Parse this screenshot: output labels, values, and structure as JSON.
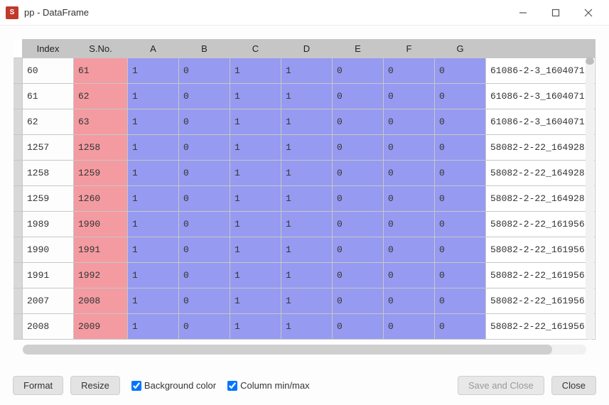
{
  "window": {
    "title": "pp - DataFrame",
    "app_icon_text": "S"
  },
  "table": {
    "columns": [
      "Index",
      "S.No.",
      "A",
      "B",
      "C",
      "D",
      "E",
      "F",
      "G",
      ""
    ],
    "rows": [
      {
        "index": "60",
        "sno": "61",
        "A": "1",
        "B": "0",
        "C": "1",
        "D": "1",
        "E": "0",
        "F": "0",
        "G": "0",
        "last": "61086-2-3_1604071"
      },
      {
        "index": "61",
        "sno": "62",
        "A": "1",
        "B": "0",
        "C": "1",
        "D": "1",
        "E": "0",
        "F": "0",
        "G": "0",
        "last": "61086-2-3_1604071"
      },
      {
        "index": "62",
        "sno": "63",
        "A": "1",
        "B": "0",
        "C": "1",
        "D": "1",
        "E": "0",
        "F": "0",
        "G": "0",
        "last": "61086-2-3_1604071"
      },
      {
        "index": "1257",
        "sno": "1258",
        "A": "1",
        "B": "0",
        "C": "1",
        "D": "1",
        "E": "0",
        "F": "0",
        "G": "0",
        "last": "58082-2-22_164928"
      },
      {
        "index": "1258",
        "sno": "1259",
        "A": "1",
        "B": "0",
        "C": "1",
        "D": "1",
        "E": "0",
        "F": "0",
        "G": "0",
        "last": "58082-2-22_164928"
      },
      {
        "index": "1259",
        "sno": "1260",
        "A": "1",
        "B": "0",
        "C": "1",
        "D": "1",
        "E": "0",
        "F": "0",
        "G": "0",
        "last": "58082-2-22_164928"
      },
      {
        "index": "1989",
        "sno": "1990",
        "A": "1",
        "B": "0",
        "C": "1",
        "D": "1",
        "E": "0",
        "F": "0",
        "G": "0",
        "last": "58082-2-22_161956"
      },
      {
        "index": "1990",
        "sno": "1991",
        "A": "1",
        "B": "0",
        "C": "1",
        "D": "1",
        "E": "0",
        "F": "0",
        "G": "0",
        "last": "58082-2-22_161956"
      },
      {
        "index": "1991",
        "sno": "1992",
        "A": "1",
        "B": "0",
        "C": "1",
        "D": "1",
        "E": "0",
        "F": "0",
        "G": "0",
        "last": "58082-2-22_161956"
      },
      {
        "index": "2007",
        "sno": "2008",
        "A": "1",
        "B": "0",
        "C": "1",
        "D": "1",
        "E": "0",
        "F": "0",
        "G": "0",
        "last": "58082-2-22_161956"
      },
      {
        "index": "2008",
        "sno": "2009",
        "A": "1",
        "B": "0",
        "C": "1",
        "D": "1",
        "E": "0",
        "F": "0",
        "G": "0",
        "last": "58082-2-22_161956"
      }
    ]
  },
  "footer": {
    "format_label": "Format",
    "resize_label": "Resize",
    "bgcolor_label": "Background color",
    "minmax_label": "Column min/max",
    "save_label": "Save and Close",
    "close_label": "Close",
    "bgcolor_checked": true,
    "minmax_checked": true
  }
}
